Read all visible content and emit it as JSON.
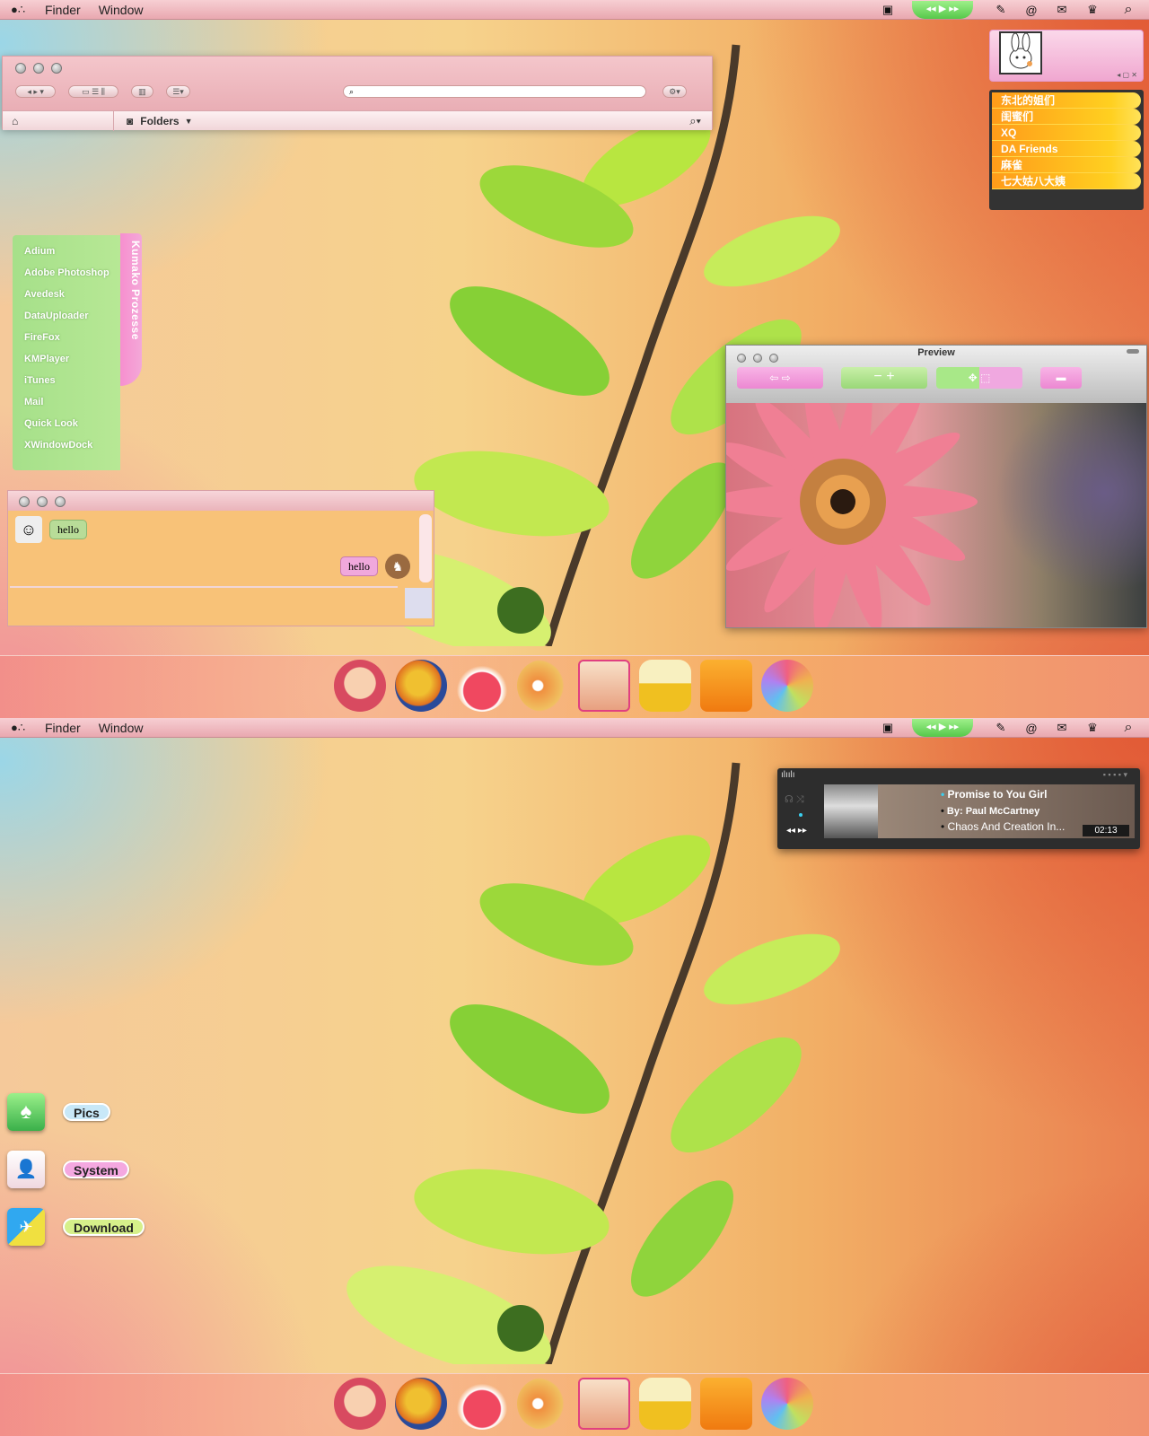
{
  "menubar": {
    "app_menu": "Finder",
    "window_menu": "Window",
    "paw_icon": "paw-icon",
    "right_icons": [
      "pathfinder-icon",
      "playback-controls",
      "pen-icon",
      "swirl-icon",
      "mail-icon",
      "crown-icon",
      "search-icon"
    ]
  },
  "finder": {
    "path_label": "Folders"
  },
  "processes": {
    "tab_label": "Kumako Prozesse",
    "items": [
      "Adium",
      "Adobe Photoshop",
      "Avedesk",
      "DataUploader",
      "FireFox",
      "KMPlayer",
      "iTunes",
      "Mail",
      "Quick Look",
      "XWindowDock"
    ]
  },
  "buddy_groups": [
    "东北的姐们",
    "闺蜜们",
    "XQ",
    "DA Friends",
    "麻雀",
    "七大姑八大姨"
  ],
  "chat": {
    "incoming": "hello",
    "outgoing": "hello"
  },
  "preview": {
    "title": "Preview"
  },
  "music": {
    "track": "Promise to You Girl",
    "artist": "By: Paul McCartney",
    "album": "Chaos And Creation In...",
    "time": "02:13"
  },
  "desktop_folders": [
    {
      "label": "Pics",
      "color": "#7fdc6e"
    },
    {
      "label": "System",
      "color": "#f4a8e0"
    },
    {
      "label": "Download",
      "color": "#d6f08a"
    }
  ],
  "dock_icons": [
    "cooking-mama-icon",
    "firefox-icon",
    "ice-cream-icon",
    "music-disc-icon",
    "donut-box-icon",
    "camper-van-icon",
    "orange-juice-icon",
    "color-wheel-icon"
  ],
  "colors": {
    "menubar": "#f2bcc2",
    "process_panel": "#a6e08a",
    "group_bar": "#ffb020"
  }
}
